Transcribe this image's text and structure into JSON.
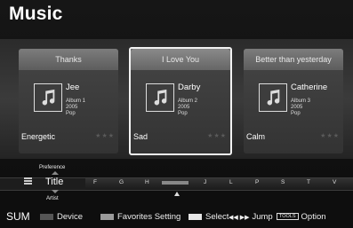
{
  "page_title": "Music",
  "cards": [
    {
      "song": "Thanks",
      "artist": "Jee",
      "album": "Album 1",
      "year": "2005",
      "genre": "Pop",
      "mood": "Energetic",
      "stars": "★★★",
      "selected": false
    },
    {
      "song": "I Love You",
      "artist": "Darby",
      "album": "Album 2",
      "year": "2005",
      "genre": "Pop",
      "mood": "Sad",
      "stars": "★★★",
      "selected": true
    },
    {
      "song": "Better than yesterday",
      "artist": "Catherine",
      "album": "Album 3",
      "year": "2005",
      "genre": "Pop",
      "mood": "Calm",
      "stars": "★★★",
      "selected": false
    }
  ],
  "sort": {
    "previous": "Preference",
    "current": "Title",
    "next": "Artist"
  },
  "jump_letters": [
    "F",
    "G",
    "H",
    "J",
    "L",
    "P",
    "S",
    "T",
    "V"
  ],
  "footer": {
    "sum": "SUM",
    "device": "Device",
    "favorites": "Favorites Setting",
    "select": "Select",
    "jump_glyph": "◀◀ ▶▶",
    "jump": "Jump",
    "tools_badge": "TOOLS",
    "option": "Option"
  },
  "colors": {
    "device_swatch": "#555555",
    "favorites_swatch": "#9a9a9a",
    "select_swatch": "#e6e6e6"
  }
}
